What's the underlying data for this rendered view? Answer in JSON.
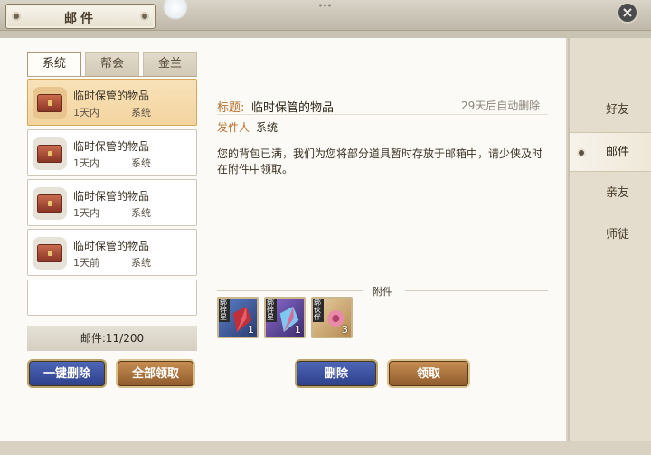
{
  "window": {
    "title": "邮件",
    "close_icon": "×"
  },
  "tabs": [
    "系统",
    "帮会",
    "金兰"
  ],
  "mails": [
    {
      "name": "临时保管的物品",
      "time": "1天内",
      "sender": "系统",
      "icon": "chest-icon",
      "selected": true
    },
    {
      "name": "临时保管的物品",
      "time": "1天内",
      "sender": "系统",
      "icon": "chest-icon",
      "selected": false
    },
    {
      "name": "临时保管的物品",
      "time": "1天内",
      "sender": "系统",
      "icon": "chest-icon",
      "selected": false
    },
    {
      "name": "临时保管的物品",
      "time": "1天前",
      "sender": "系统",
      "icon": "chest-icon",
      "selected": false
    }
  ],
  "mail_count": "邮件:11/200",
  "buttons": {
    "delete_all": "一键删除",
    "claim_all": "全部领取",
    "delete": "删除",
    "claim": "领取"
  },
  "detail": {
    "title_label": "标题:",
    "title": "临时保管的物品",
    "auto_delete": "29天后自动删除",
    "sender_label": "发件人",
    "sender": "系统",
    "body": "您的背包已满，我们为您将部分道具暂时存放于邮箱中，请少侠及时在附件中领取。",
    "attachment_label": "附件",
    "attachments": [
      {
        "tag": "绑碎星",
        "qty": "1",
        "icon": "red-shard-icon",
        "color": "#3b5a9c"
      },
      {
        "tag": "绑碎星",
        "qty": "1",
        "icon": "purple-shard-icon",
        "color": "#6a4a9c"
      },
      {
        "tag": "绑伙伴",
        "qty": "3",
        "icon": "companion-token-icon",
        "color": "#c9a76a"
      }
    ]
  },
  "side_nav": [
    "好友",
    "邮件",
    "亲友",
    "师徒"
  ],
  "side_nav_active": 1
}
